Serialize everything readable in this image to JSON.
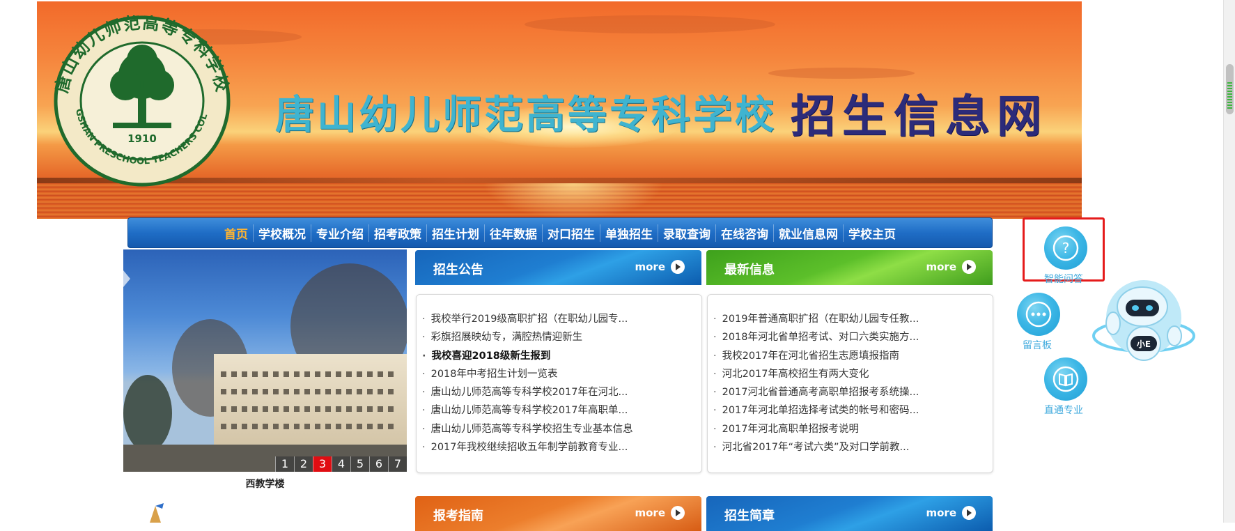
{
  "banner": {
    "school_name": "唐山幼儿师范高等专科学校",
    "site_name": "招生信息网",
    "seal": {
      "top_text": "唐山幼儿师范高等专科学校",
      "bottom_text": "TANGSHAN PRESCHOOL TEACHERS COLLEGE",
      "year": "1910"
    }
  },
  "nav": {
    "items": [
      {
        "label": "首页",
        "active": true
      },
      {
        "label": "学校概况"
      },
      {
        "label": "专业介绍"
      },
      {
        "label": "招考政策"
      },
      {
        "label": "招生计划"
      },
      {
        "label": "往年数据"
      },
      {
        "label": "对口招生"
      },
      {
        "label": "单独招生"
      },
      {
        "label": "录取查询"
      },
      {
        "label": "在线咨询"
      },
      {
        "label": "就业信息网"
      },
      {
        "label": "学校主页"
      }
    ]
  },
  "slideshow": {
    "caption": "西教学楼",
    "pages": [
      "1",
      "2",
      "3",
      "4",
      "5",
      "6",
      "7"
    ],
    "active_page": "3"
  },
  "panels": {
    "admission_notice": {
      "title": "招生公告",
      "more": "more",
      "items": [
        {
          "text": "我校举行2019级高职扩招（在职幼儿园专..."
        },
        {
          "text": "彩旗招展映幼专，满腔热情迎新生"
        },
        {
          "text": "我校喜迎2018级新生报到",
          "bold": true
        },
        {
          "text": "2018年中考招生计划一览表"
        },
        {
          "text": "唐山幼儿师范高等专科学校2017年在河北..."
        },
        {
          "text": "唐山幼儿师范高等专科学校2017年高职单..."
        },
        {
          "text": "唐山幼儿师范高等专科学校招生专业基本信息"
        },
        {
          "text": "2017年我校继续招收五年制学前教育专业..."
        }
      ]
    },
    "latest_info": {
      "title": "最新信息",
      "more": "more",
      "items": [
        {
          "text": "2019年普通高职扩招（在职幼儿园专任教..."
        },
        {
          "text": "2018年河北省单招考试、对口六类实施方..."
        },
        {
          "text": "我校2017年在河北省招生志愿填报指南"
        },
        {
          "text": "河北2017年高校招生有两大变化"
        },
        {
          "text": "2017河北省普通高考高职单招报考系统操..."
        },
        {
          "text": "2017年河北单招选择考试类的帐号和密码..."
        },
        {
          "text": "2017年河北高职单招报考说明"
        },
        {
          "text": "河北省2017年“考试六类”及对口学前教..."
        }
      ]
    },
    "exam_guide": {
      "title": "报考指南",
      "more": "more"
    },
    "admission_brochure": {
      "title": "招生简章",
      "more": "more"
    }
  },
  "side_tools": {
    "qa": {
      "label": "智能问答",
      "icon": "question-icon"
    },
    "message": {
      "label": "留言板",
      "icon": "ellipsis-icon"
    },
    "majors": {
      "label": "直通专业",
      "icon": "book-icon"
    },
    "robot": {
      "badge": "小E",
      "icon": "robot-icon"
    }
  }
}
